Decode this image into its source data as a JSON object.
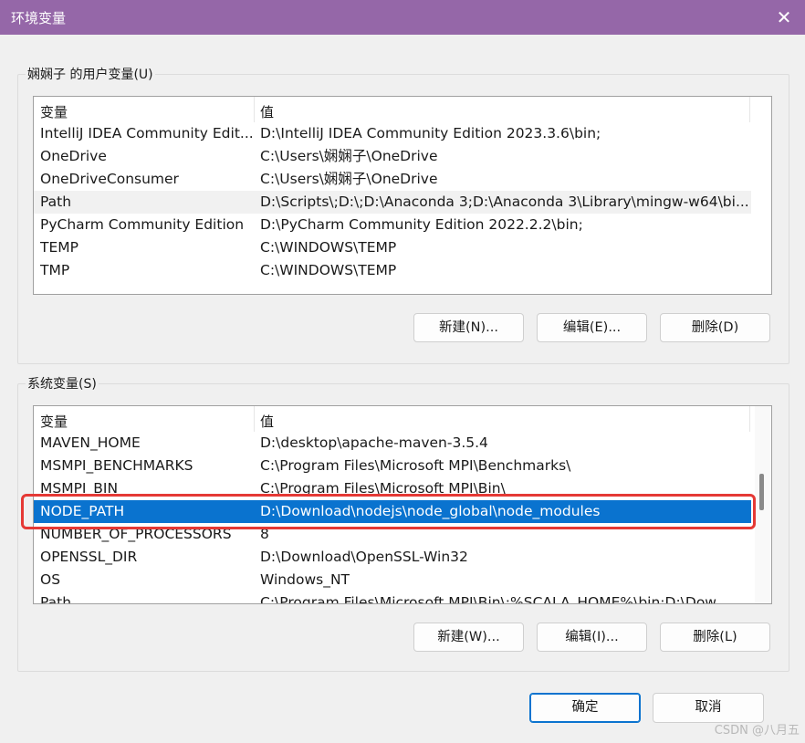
{
  "window": {
    "title": "环境变量",
    "close_glyph": "✕",
    "titlebar_color": "#9567a8"
  },
  "user_vars": {
    "group_label": "娴娴子 的用户变量(U)",
    "col_name": "变量",
    "col_value": "值",
    "rows": [
      {
        "name": "IntelliJ IDEA Community Edit...",
        "value": "D:\\IntelliJ IDEA Community Edition 2023.3.6\\bin;"
      },
      {
        "name": "OneDrive",
        "value": "C:\\Users\\娴娴子\\OneDrive"
      },
      {
        "name": "OneDriveConsumer",
        "value": "C:\\Users\\娴娴子\\OneDrive"
      },
      {
        "name": "Path",
        "value": "D:\\Scripts\\;D:\\;D:\\Anaconda 3;D:\\Anaconda 3\\Library\\mingw-w64\\bi..."
      },
      {
        "name": "PyCharm Community Edition",
        "value": "D:\\PyCharm Community Edition 2022.2.2\\bin;"
      },
      {
        "name": "TEMP",
        "value": "C:\\WINDOWS\\TEMP"
      },
      {
        "name": "TMP",
        "value": "C:\\WINDOWS\\TEMP"
      }
    ],
    "buttons": {
      "new": "新建(N)...",
      "edit": "编辑(E)...",
      "delete": "删除(D)"
    }
  },
  "system_vars": {
    "group_label": "系统变量(S)",
    "col_name": "变量",
    "col_value": "值",
    "rows": [
      {
        "name": "MAVEN_HOME",
        "value": "D:\\desktop\\apache-maven-3.5.4"
      },
      {
        "name": "MSMPI_BENCHMARKS",
        "value": "C:\\Program Files\\Microsoft MPI\\Benchmarks\\"
      },
      {
        "name": "MSMPI_BIN",
        "value": "C:\\Program Files\\Microsoft MPI\\Bin\\"
      },
      {
        "name": "NODE_PATH",
        "value": "D:\\Download\\nodejs\\node_global\\node_modules"
      },
      {
        "name": "NUMBER_OF_PROCESSORS",
        "value": "8"
      },
      {
        "name": "OPENSSL_DIR",
        "value": "D:\\Download\\OpenSSL-Win32"
      },
      {
        "name": "OS",
        "value": "Windows_NT"
      },
      {
        "name": "Path",
        "value": "C:\\Program Files\\Microsoft MPI\\Bin\\;%SCALA_HOME%\\bin;D:\\Dow..."
      }
    ],
    "selected_row": "NODE_PATH",
    "buttons": {
      "new": "新建(W)...",
      "edit": "编辑(I)...",
      "delete": "删除(L)"
    }
  },
  "dialog_buttons": {
    "ok": "确定",
    "cancel": "取消"
  },
  "annotation": {
    "highlight_color": "#e53935"
  },
  "watermark": "CSDN @八月五"
}
